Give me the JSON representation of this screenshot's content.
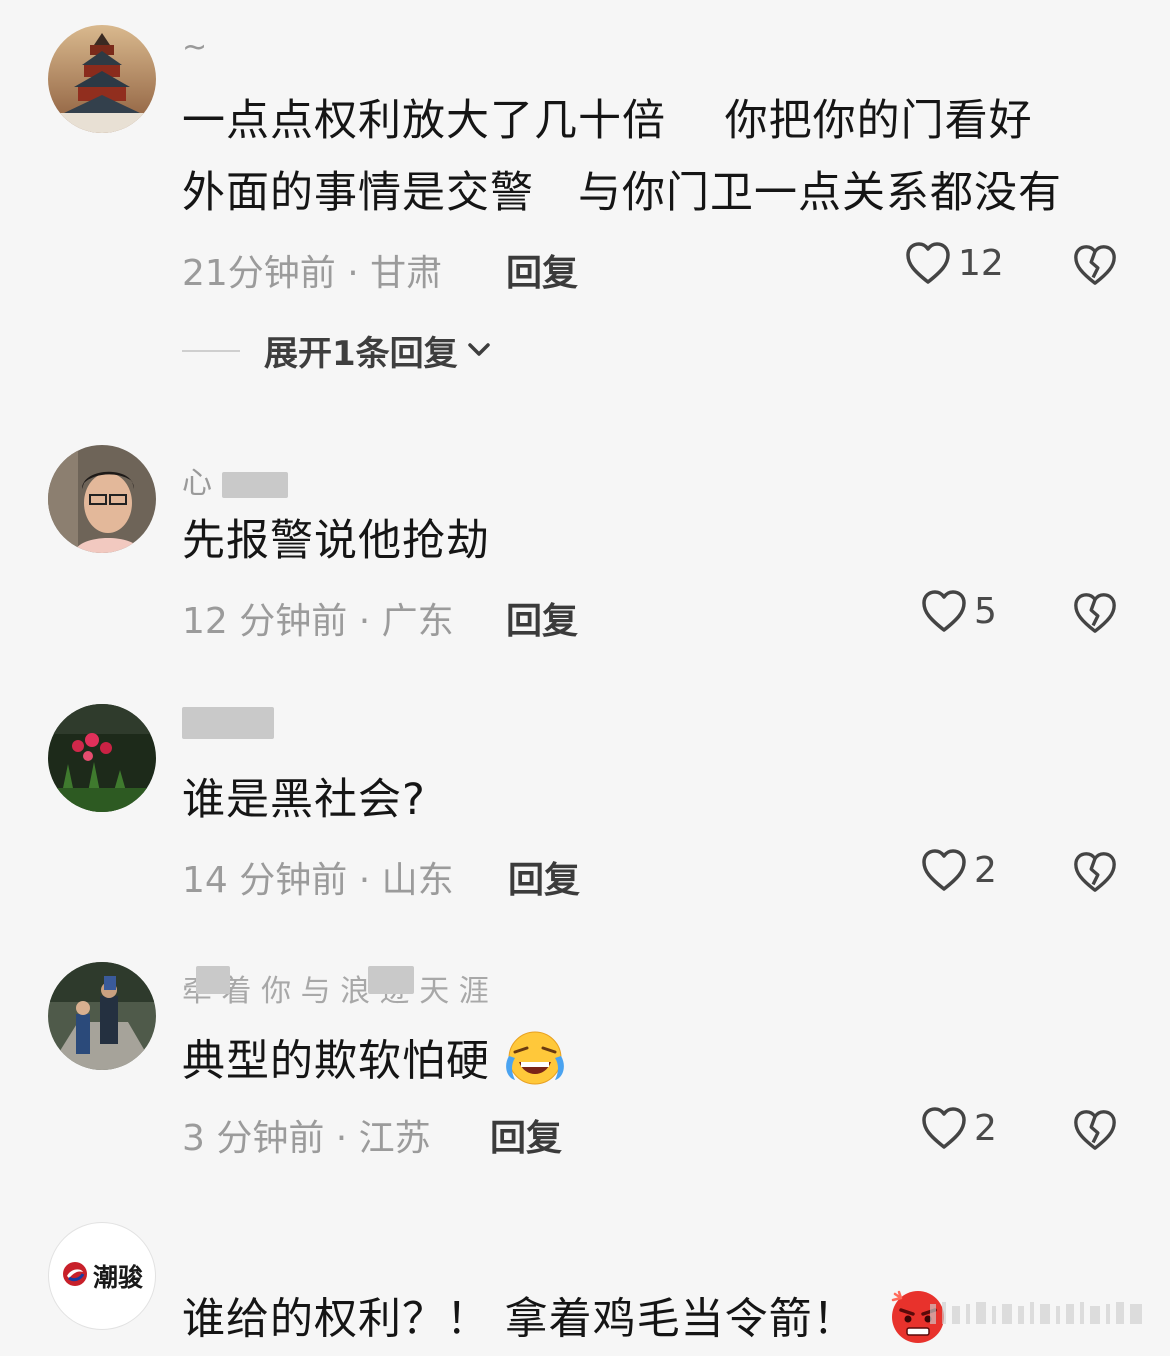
{
  "comments": [
    {
      "username": "~",
      "lines": [
        "一点点权利放大了几十倍　 你把你的门看好",
        "外面的事情是交警　与你门卫一点关系都没有"
      ],
      "time_location": "21分钟前 · 甘肃",
      "reply_label": "回复",
      "likes": "12",
      "expand_label": "展开1条回复"
    },
    {
      "username": "心",
      "lines": [
        "先报警说他抢劫"
      ],
      "time_location": "12 分钟前 · 广东",
      "reply_label": "回复",
      "likes": "5"
    },
    {
      "username": "",
      "lines": [
        "谁是黑社会?"
      ],
      "time_location": "14 分钟前 · 山东",
      "reply_label": "回复",
      "likes": "2"
    },
    {
      "username": "牵 着 你 与 浪 迹 天 涯",
      "lines": [
        "典型的欺软怕硬"
      ],
      "time_location": "3 分钟前 · 江苏",
      "reply_label": "回复",
      "likes": "2",
      "emoji": "grimacing-tears-emoji"
    },
    {
      "avatar_text": "潮骏",
      "lines": [
        "谁给的权利？！ 拿着鸡毛当令箭！"
      ],
      "emoji": "angry-face-emoji"
    }
  ],
  "icons": {
    "like": "heart-outline-icon",
    "dislike": "broken-heart-icon",
    "expand": "chevron-down-icon"
  },
  "colors": {
    "background": "#f6f6f6",
    "text": "#151515",
    "meta": "#9b9b9b"
  }
}
